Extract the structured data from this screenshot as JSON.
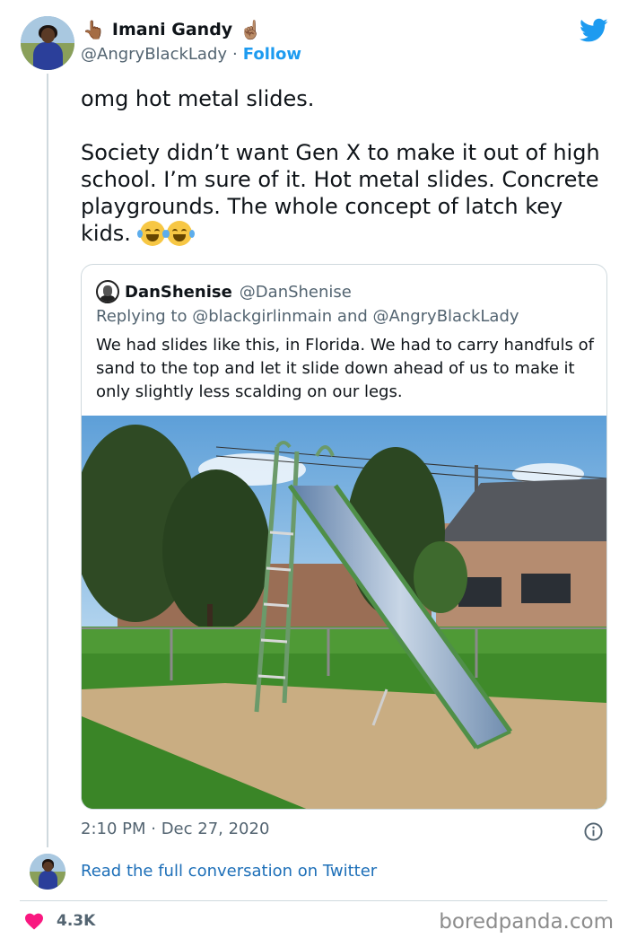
{
  "author": {
    "display_name": "Imani Gandy",
    "handle": "@AngryBlackLady",
    "separator": "·",
    "follow_label": "Follow",
    "name_emoji_left": "👆🏾",
    "name_emoji_right": "☝🏽"
  },
  "tweet": {
    "paragraphs": [
      "omg hot metal slides.",
      "Society didn’t want Gen X to make it out of high school. I’m sure of it. Hot metal slides. Concrete playgrounds. The whole concept of latch key kids."
    ],
    "emojis": [
      "tears-of-joy",
      "tears-of-joy"
    ],
    "timestamp": "2:10 PM · Dec 27, 2020"
  },
  "quoted": {
    "display_name": "DanShenise",
    "handle": "@DanShenise",
    "replying_to": "Replying to @blackgirlinmain and @AngryBlackLady",
    "text": "We had slides like this, in Florida. We had to carry handfuls of sand to the top and let it slide down ahead of us to make it only slightly less scalding on our legs."
  },
  "footer": {
    "read_link": "Read the full conversation on Twitter",
    "like_count": "4.3K"
  },
  "watermark": "boredpanda.com",
  "colors": {
    "twitter_blue": "#1d9bf0",
    "link_blue": "#1d6fb8",
    "heart_red": "#f91880",
    "muted_gray": "#536471",
    "border": "#cfd9de"
  }
}
